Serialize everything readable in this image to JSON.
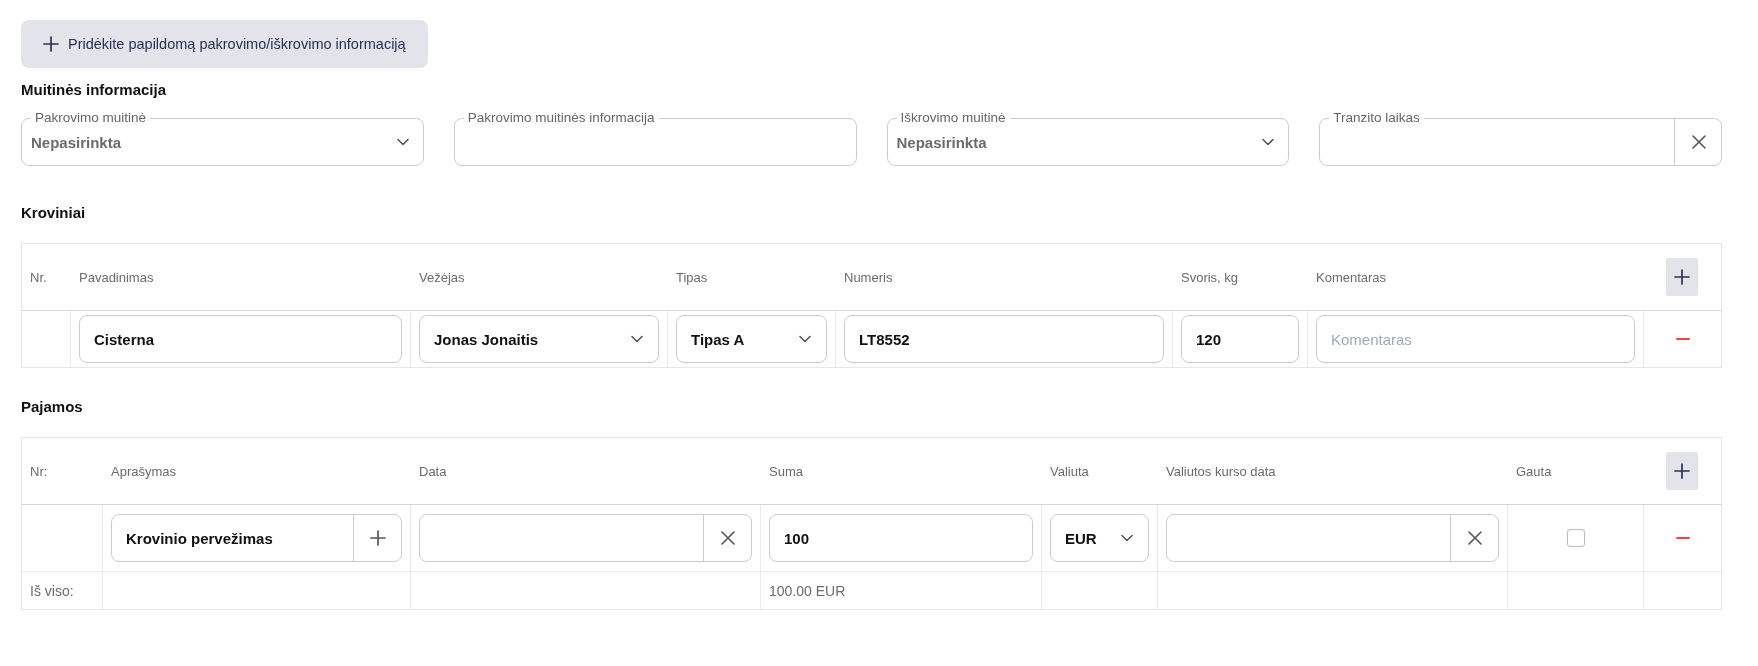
{
  "add_info_button": {
    "label": "Pridėkite papildomą pakrovimo/iškrovimo informaciją"
  },
  "customs": {
    "title": "Muitinės informacija",
    "fields": [
      {
        "kind": "select",
        "label": "Pakrovimo muitinė",
        "value": "Nepasirinkta"
      },
      {
        "kind": "text",
        "label": "Pakrovimo muitinės informacija"
      },
      {
        "kind": "select",
        "label": "Iškrovimo muitinė",
        "value": "Nepasirinkta"
      },
      {
        "kind": "clearable",
        "label": "Tranzito laikas"
      }
    ]
  },
  "cargo": {
    "title": "Kroviniai",
    "columns": [
      "Nr.",
      "Pavadinimas",
      "Vežėjas",
      "Tipas",
      "Numeris",
      "Svoris, kg",
      "Komentaras"
    ],
    "rows": [
      {
        "name": "Cisterna",
        "carrier": "Jonas Jonaitis",
        "type": "Tipas A",
        "number": "LT8552",
        "weight": "120",
        "comment_placeholder": "Komentaras"
      }
    ]
  },
  "income": {
    "title": "Pajamos",
    "columns": [
      "Nr:",
      "Aprašymas",
      "Data",
      "Suma",
      "Valiuta",
      "Valiutos kurso data",
      "Gauta"
    ],
    "rows": [
      {
        "description": "Krovinio pervežimas",
        "amount": "100",
        "currency": "EUR",
        "received": false
      }
    ],
    "total": {
      "label": "Iš viso:",
      "amount": "100.00 EUR"
    }
  }
}
